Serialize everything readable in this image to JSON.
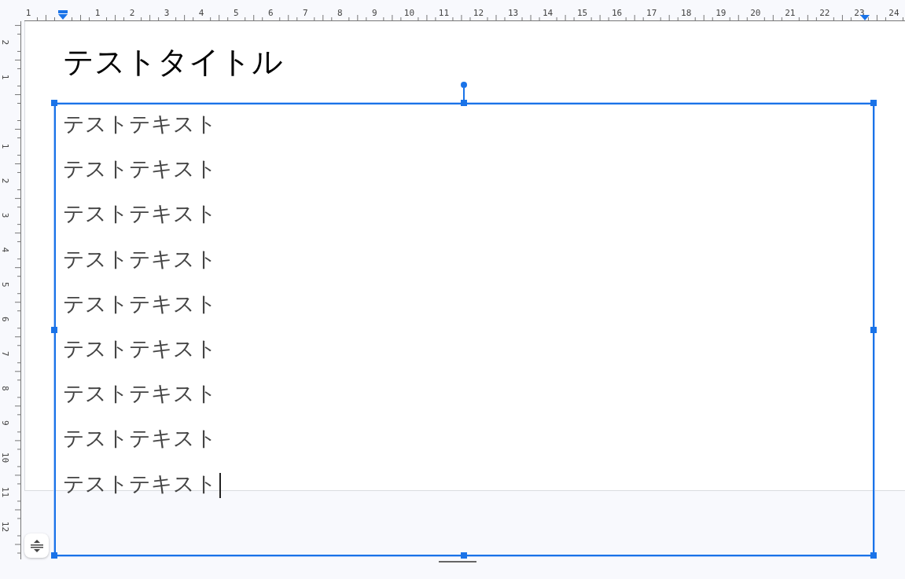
{
  "top_ruler": {
    "before_zero": [
      "1"
    ],
    "after_zero": [
      "1",
      "2",
      "3",
      "4",
      "5",
      "6",
      "7",
      "8",
      "9",
      "10",
      "11",
      "12",
      "13",
      "14",
      "15",
      "16",
      "17",
      "18",
      "19",
      "20",
      "21",
      "22",
      "23",
      "24"
    ]
  },
  "left_ruler": {
    "before_zero": [
      "2",
      "1"
    ],
    "after_zero": [
      "1",
      "2",
      "3",
      "4",
      "5",
      "6",
      "7",
      "8",
      "9",
      "10",
      "11",
      "12"
    ]
  },
  "slide": {
    "title": "テストタイトル",
    "text_box": {
      "selected": true,
      "lines": [
        "テストテキスト",
        "テストテキスト",
        "テストテキスト",
        "テストテキスト",
        "テストテキスト",
        "テストテキスト",
        "テストテキスト",
        "テストテキスト",
        "テストテキスト"
      ]
    }
  }
}
